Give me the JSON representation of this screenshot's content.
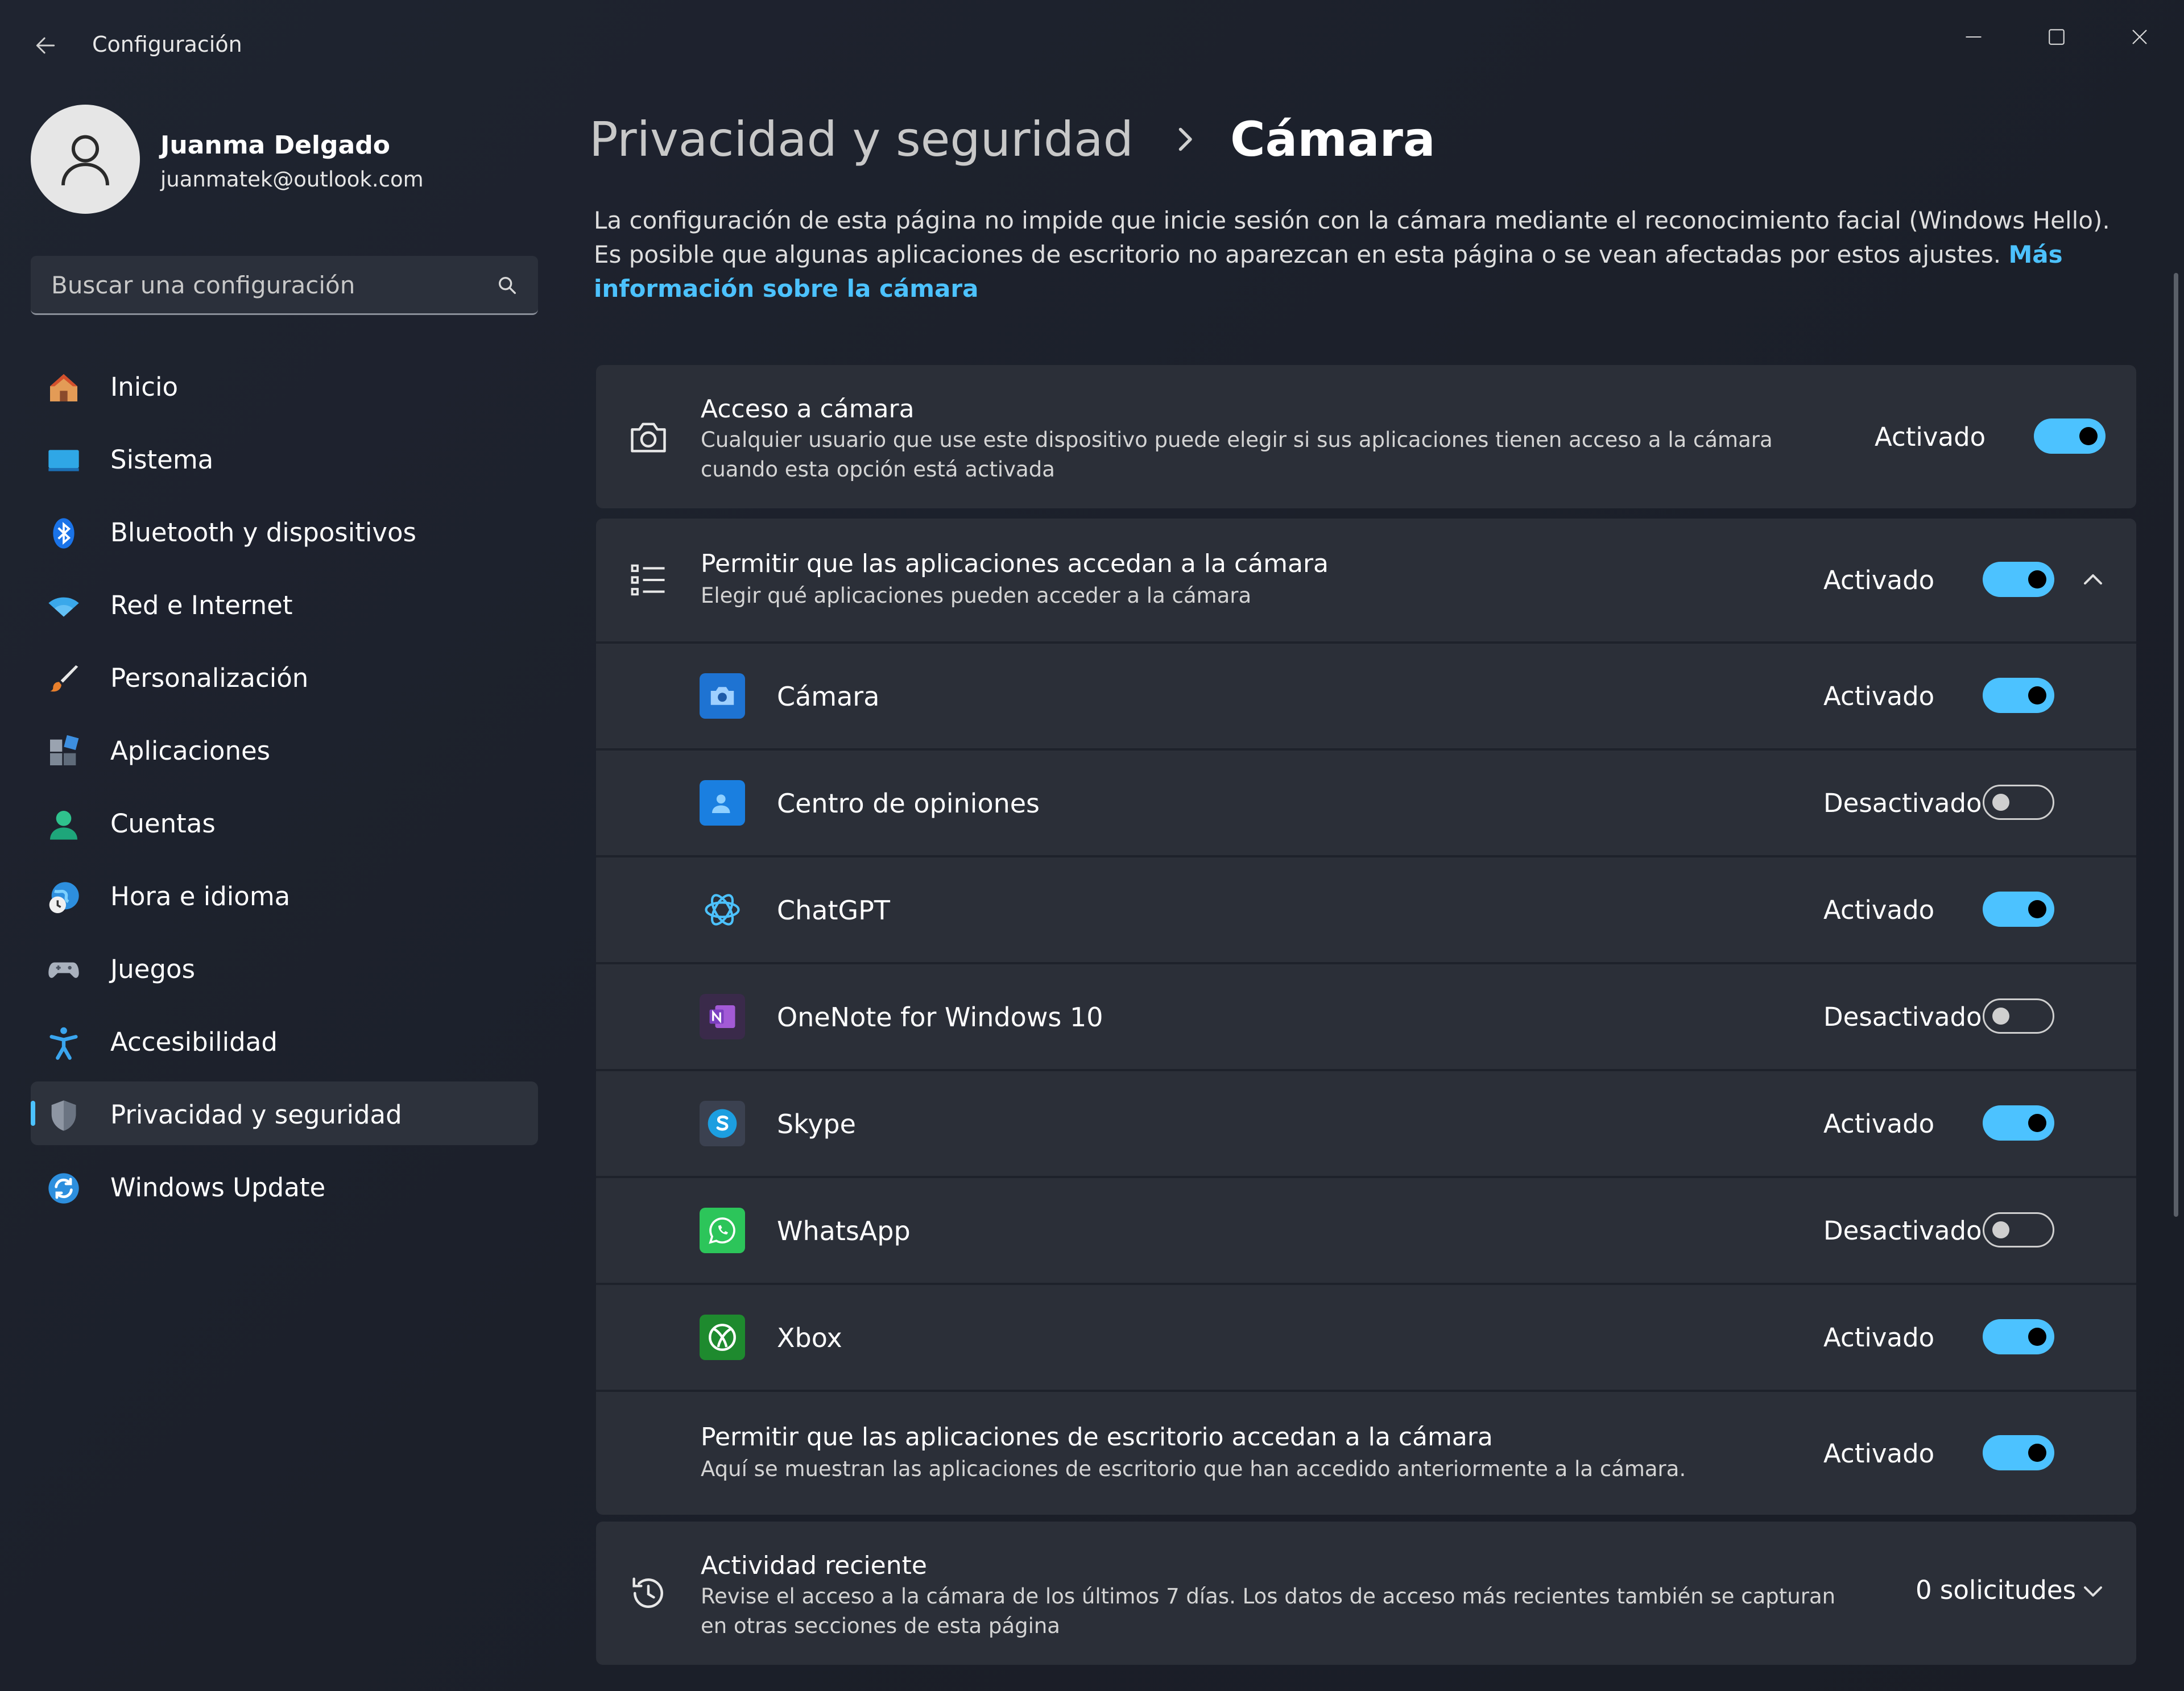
{
  "titlebar": {
    "app_title": "Configuración"
  },
  "user": {
    "name": "Juanma Delgado",
    "email": "juanmatek@outlook.com"
  },
  "search": {
    "placeholder": "Buscar una configuración"
  },
  "sidebar": {
    "items": [
      {
        "label": "Inicio",
        "icon": "home-icon"
      },
      {
        "label": "Sistema",
        "icon": "system-icon"
      },
      {
        "label": "Bluetooth y dispositivos",
        "icon": "bluetooth-icon"
      },
      {
        "label": "Red e Internet",
        "icon": "wifi-icon"
      },
      {
        "label": "Personalización",
        "icon": "brush-icon"
      },
      {
        "label": "Aplicaciones",
        "icon": "apps-icon"
      },
      {
        "label": "Cuentas",
        "icon": "account-icon"
      },
      {
        "label": "Hora e idioma",
        "icon": "clock-globe-icon"
      },
      {
        "label": "Juegos",
        "icon": "gamepad-icon"
      },
      {
        "label": "Accesibilidad",
        "icon": "accessibility-icon"
      },
      {
        "label": "Privacidad y seguridad",
        "icon": "shield-icon",
        "active": true
      },
      {
        "label": "Windows Update",
        "icon": "update-icon"
      }
    ]
  },
  "breadcrumb": {
    "parent": "Privacidad y seguridad",
    "current": "Cámara"
  },
  "description": {
    "text": "La configuración de esta página no impide que inicie sesión con la cámara mediante el reconocimiento facial (Windows Hello). Es posible que algunas aplicaciones de escritorio no aparezcan en esta página o se vean afectadas por estos ajustes.",
    "link": "Más información sobre la cámara"
  },
  "camera_access": {
    "title": "Acceso a cámara",
    "subtitle": "Cualquier usuario que use este dispositivo puede elegir si sus aplicaciones tienen acceso a la cámara cuando esta opción está activada",
    "state": "Activado",
    "on": true
  },
  "apps_access": {
    "title": "Permitir que las aplicaciones accedan a la cámara",
    "subtitle": "Elegir qué aplicaciones pueden acceder a la cámara",
    "state": "Activado",
    "on": true,
    "expanded": true
  },
  "apps": [
    {
      "name": "Cámara",
      "state": "Activado",
      "on": true,
      "icon": "camera-app-icon",
      "color": "#1e73d2"
    },
    {
      "name": "Centro de opiniones",
      "state": "Desactivado",
      "on": false,
      "icon": "feedback-hub-icon",
      "color": "#1a7fe0"
    },
    {
      "name": "ChatGPT",
      "state": "Activado",
      "on": true,
      "icon": "chatgpt-icon",
      "color": "#4cc2ff"
    },
    {
      "name": "OneNote for Windows 10",
      "state": "Desactivado",
      "on": false,
      "icon": "onenote-icon",
      "color": "#7b3fbf"
    },
    {
      "name": "Skype",
      "state": "Activado",
      "on": true,
      "icon": "skype-icon",
      "color": "#1c9ee0"
    },
    {
      "name": "WhatsApp",
      "state": "Desactivado",
      "on": false,
      "icon": "whatsapp-icon",
      "color": "#2cc55a"
    },
    {
      "name": "Xbox",
      "state": "Activado",
      "on": true,
      "icon": "xbox-icon",
      "color": "#1e8a2e"
    }
  ],
  "desktop_apps": {
    "title": "Permitir que las aplicaciones de escritorio accedan a la cámara",
    "subtitle": "Aquí se muestran las aplicaciones de escritorio que han accedido anteriormente a la cámara.",
    "state": "Activado",
    "on": true
  },
  "recent_activity": {
    "title": "Actividad reciente",
    "subtitle": "Revise el acceso a la cámara de los últimos 7 días. Los datos de acceso más recientes también se capturan en otras secciones de esta página",
    "count": "0 solicitudes"
  },
  "colors": {
    "accent": "#4cc2ff",
    "card": "#2b2f38",
    "background": "#1d222d"
  }
}
